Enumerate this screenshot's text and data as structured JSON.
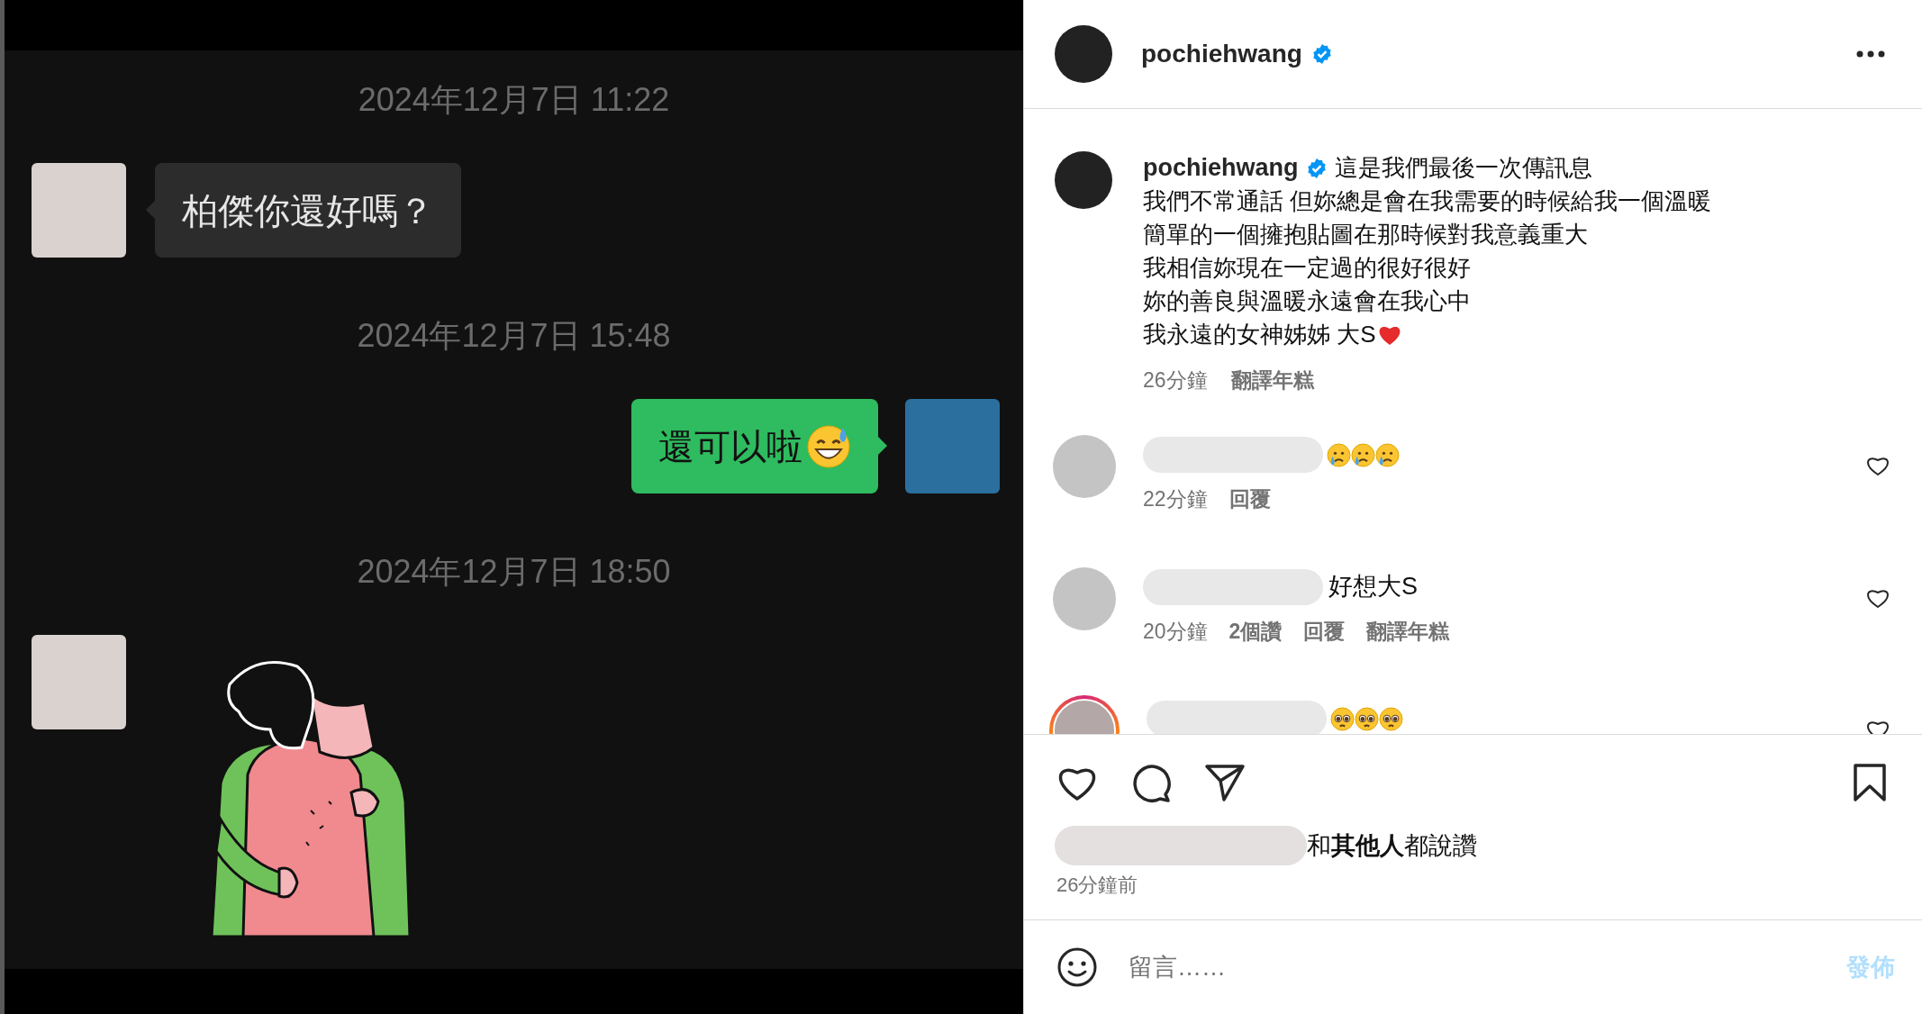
{
  "chat": {
    "messages": [
      {
        "kind": "timestamp",
        "text": "2024年12月7日 11:22"
      },
      {
        "kind": "incoming",
        "text": "柏傑你還好嗎？"
      },
      {
        "kind": "timestamp",
        "text": "2024年12月7日 15:48"
      },
      {
        "kind": "outgoing",
        "text": "還可以啦",
        "emoji": {
          "kind": "sweat-smile"
        }
      },
      {
        "kind": "timestamp",
        "text": "2024年12月7日 18:50"
      },
      {
        "kind": "sticker"
      }
    ]
  },
  "post": {
    "username": "pochiehwang",
    "verified": true,
    "caption": {
      "username": "pochiehwang",
      "verified": true,
      "lines": [
        {
          "text": "這是我們最後一次傳訊息"
        },
        {
          "text": "我們不常通話 但妳總是會在我需要的時候給我一個溫暖"
        },
        {
          "text": "簡單的一個擁抱貼圖在那時候對我意義重大"
        },
        {
          "text": "我相信妳現在一定過的很好很好"
        },
        {
          "text": "妳的善良與溫暖永遠會在我心中"
        },
        {
          "text": "我永遠的女神姊姊 大S",
          "icon": {
            "kind": "heart"
          }
        }
      ],
      "time": "26分鐘",
      "translate": "翻譯年糕"
    },
    "comments": [
      {
        "story_ring": false,
        "emojis": [
          {
            "kind": "crying"
          },
          {
            "kind": "crying"
          },
          {
            "kind": "crying"
          }
        ],
        "meta": [
          {
            "text": "22分鐘",
            "bold": false
          },
          {
            "text": "回覆",
            "bold": true
          }
        ]
      },
      {
        "story_ring": false,
        "text": "好想大S",
        "meta": [
          {
            "text": "20分鐘",
            "bold": false
          },
          {
            "text": "2個讚",
            "bold": true
          },
          {
            "text": "回覆",
            "bold": true
          },
          {
            "text": "翻譯年糕",
            "bold": true
          }
        ]
      },
      {
        "story_ring": true,
        "emojis": [
          {
            "kind": "pleading"
          },
          {
            "kind": "pleading"
          },
          {
            "kind": "pleading"
          }
        ]
      }
    ],
    "likes": "和**其他人**都說讚",
    "posted": "26分鐘前",
    "comment_box": {
      "placeholder": "留言……",
      "post_button": "發佈"
    }
  }
}
